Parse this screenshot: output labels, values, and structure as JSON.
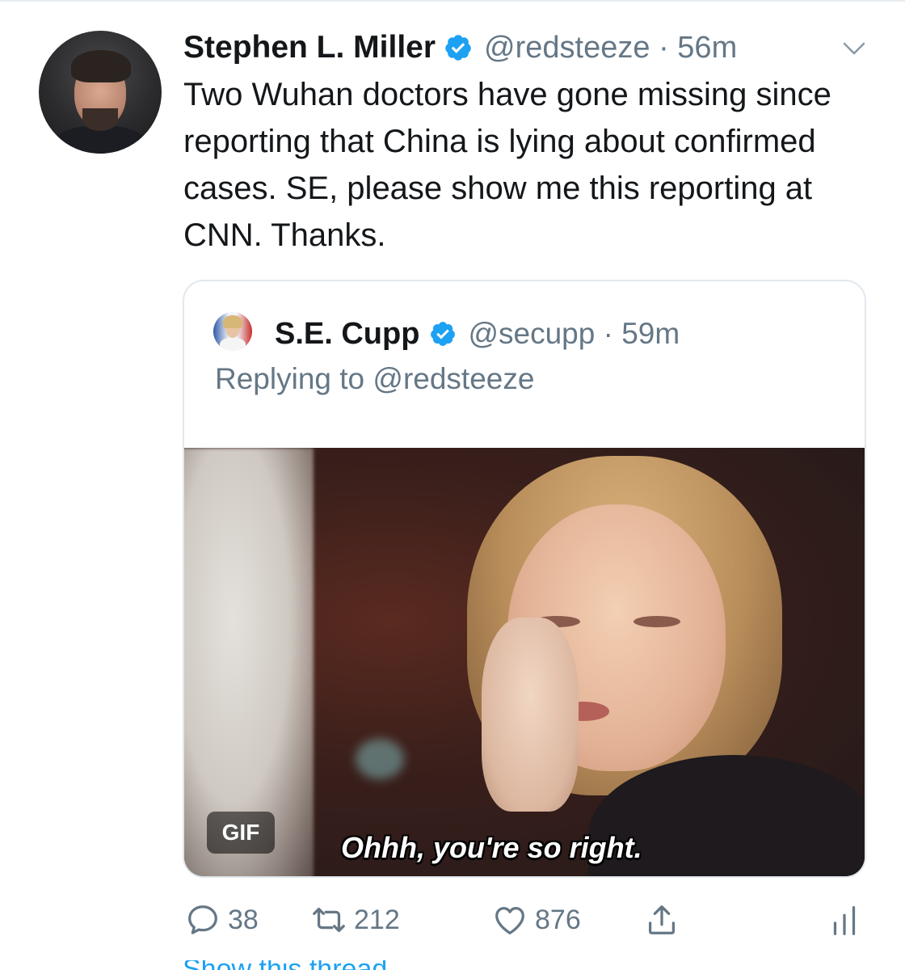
{
  "tweet": {
    "author_name": "Stephen L. Miller",
    "author_handle": "@redsteeze",
    "separator": "·",
    "time": "56m",
    "text": "Two Wuhan doctors have gone missing since reporting that China is lying about confirmed cases. SE, please show me this reporting at CNN. Thanks."
  },
  "quoted_tweet": {
    "author_name": "S.E. Cupp",
    "author_handle": "@secupp",
    "separator": "·",
    "time": "59m",
    "reply_prefix": "Replying to",
    "reply_mention": "@redsteeze",
    "media": {
      "badge": "GIF",
      "caption": "Ohhh, you're so right."
    }
  },
  "actions": {
    "reply_count": "38",
    "retweet_count": "212",
    "like_count": "876"
  },
  "bottom_link_partial": "Show this thread",
  "colors": {
    "verified": "#1da1f2",
    "muted_text": "#657786",
    "primary_text": "#14171a",
    "border": "#e1e8ed"
  }
}
